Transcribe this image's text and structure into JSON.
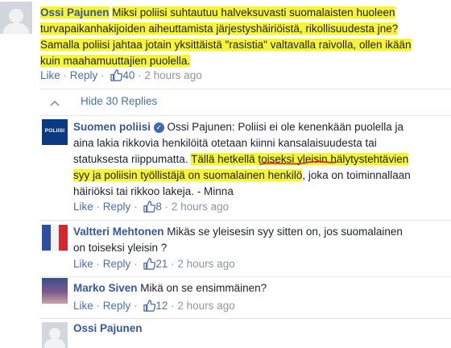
{
  "comment1": {
    "author": "Ossi Pajunen",
    "text_line1": "Miksi poliisi suhtautuu halveksuvasti suomalaisten huoleen",
    "text_line2": "turvapaikanhakijoiden aiheuttamista järjestyshäiriöistä, rikollisuudesta jne?",
    "text_line3": "Samalla poliisi jahtaa jotain yksittäistä \"rasistia\" valtavalla raivolla, ollen ikään",
    "text_line4": "kuin maahamuuttajien puolella.",
    "like": "Like",
    "reply": "Reply",
    "likes": "40",
    "time": "2 hours ago"
  },
  "replies_toggle": {
    "label": "Hide 30 Replies"
  },
  "reply1": {
    "author": "Suomen poliisi",
    "avatar_text": "POLIISI",
    "mention": "Ossi Pajunen",
    "text_a": ": Poliisi ei ole kenenkään puolella ja",
    "text_line2": "aina lakia rikkovia henkilöitä otetaan kiinni kansalaisuudesta tai",
    "text_line3a": "statuksesta riippumatta. ",
    "text_line3b": "Tällä hetkellä toiseksi yleisin hälytystehtävien",
    "text_line4a": "syy ja poliisin työllistäjä on suomalainen henkilö",
    "text_line4b": ", joka on toiminnallaan",
    "text_line5": "häiriöksi tai rikkoo lakeja. - Minna",
    "like": "Like",
    "reply": "Reply",
    "likes": "8",
    "time": "2 hours ago"
  },
  "reply2": {
    "author": "Valtteri Mehtonen",
    "text_a": " Mikäs se yleisesin syy sitten on, jos suomalainen",
    "text_line2": "on toiseksi yleisin ?",
    "like": "Like",
    "reply": "Reply",
    "likes": "21",
    "time": "2 hours ago"
  },
  "reply3": {
    "author": "Marko Siven",
    "text_a": " Mikä on se ensimmäinen?",
    "like": "Like",
    "reply": "Reply",
    "likes": "12",
    "time": "2 hours ago"
  },
  "reply4": {
    "author": "Ossi Pajunen"
  },
  "colors": {
    "link": "#365899",
    "highlight": "#f7f33a",
    "meta": "#90949c"
  }
}
